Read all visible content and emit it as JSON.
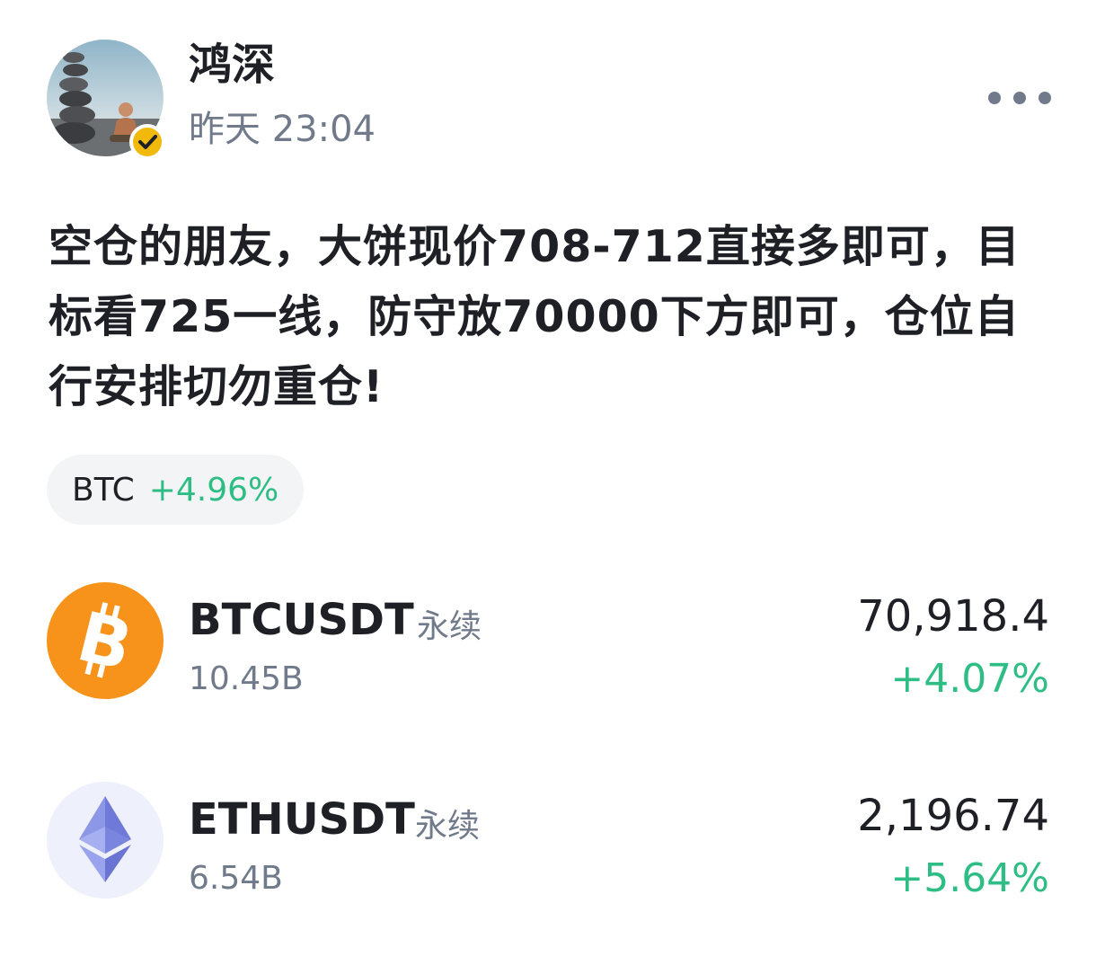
{
  "post": {
    "author": "鸿深",
    "time": "昨天 23:04",
    "body": "空仓的朋友，大饼现价708-712直接多即可，目标看725一线，防守放70000下方即可，仓位自行安排切勿重仓!"
  },
  "tag": {
    "symbol": "BTC",
    "change": "+4.96%"
  },
  "tickers": [
    {
      "pair": "BTCUSDT",
      "type": "永续",
      "volume": "10.45B",
      "price": "70,918.4",
      "change": "+4.07%",
      "icon": "bitcoin-icon"
    },
    {
      "pair": "ETHUSDT",
      "type": "永续",
      "volume": "6.54B",
      "price": "2,196.74",
      "change": "+5.64%",
      "icon": "ethereum-icon"
    }
  ],
  "colors": {
    "positive": "#2ebd85",
    "secondary_text": "#707a8a",
    "bitcoin_orange": "#f7931a",
    "verified_badge": "#f0b90b"
  }
}
